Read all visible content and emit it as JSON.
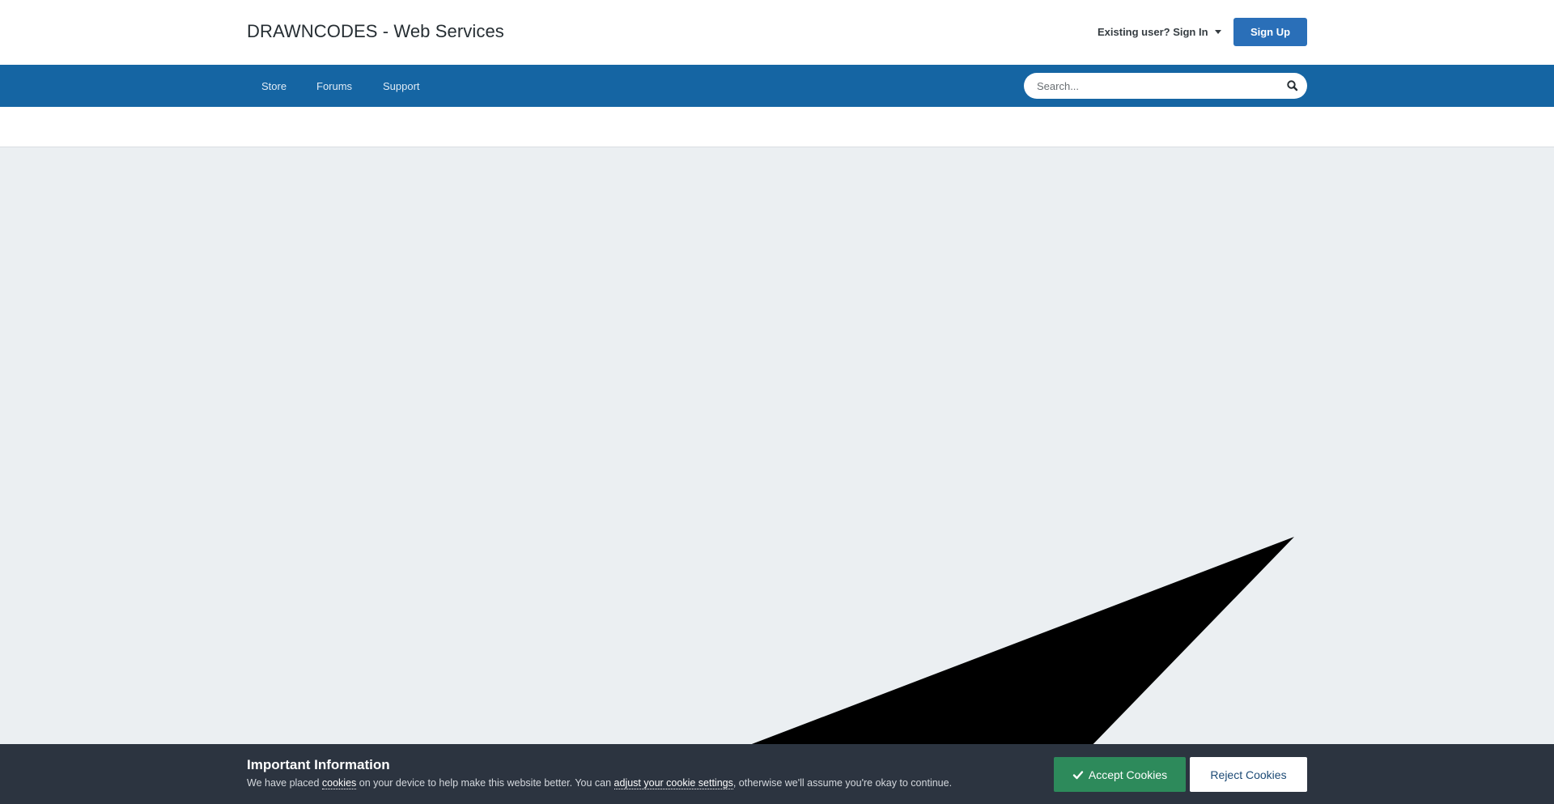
{
  "header": {
    "site_title": "DRAWNCODES - Web Services",
    "signin_label": "Existing user? Sign In",
    "signup_label": "Sign Up"
  },
  "nav": {
    "items": [
      {
        "label": "Store"
      },
      {
        "label": "Forums"
      },
      {
        "label": "Support"
      }
    ]
  },
  "search": {
    "placeholder": "Search...",
    "icon": "search-icon"
  },
  "cookie": {
    "title": "Important Information",
    "text_before": "We have placed ",
    "link_cookies": "cookies",
    "text_middle": " on your device to help make this website better. You can ",
    "link_settings": "adjust your cookie settings",
    "text_after": ", otherwise we'll assume you're okay to continue.",
    "accept_label": "Accept Cookies",
    "reject_label": "Reject Cookies"
  },
  "colors": {
    "nav_bg": "#1565a3",
    "signup_bg": "#2a6fb8",
    "accept_bg": "#2d8a5b",
    "cookie_bar_bg": "#2c3440",
    "page_bg": "#ebeff2"
  }
}
